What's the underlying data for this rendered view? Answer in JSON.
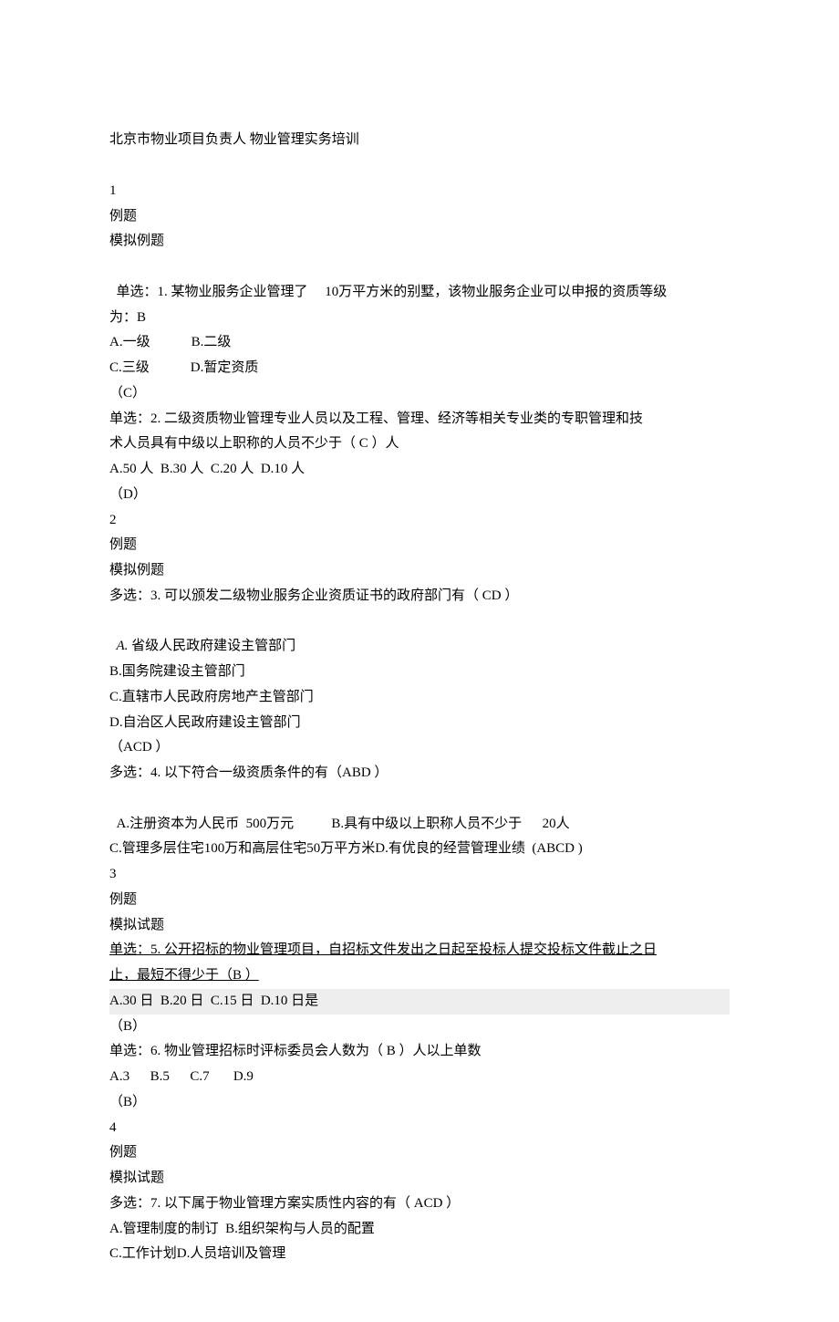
{
  "title": "北京市物业项目负责人 物业管理实务培训",
  "sections": [
    {
      "num": "1",
      "label1": "例题",
      "label2": "模拟例题",
      "q1": {
        "stem_prefix": "单选：1. 某物业服务企业管理了",
        "stem_mid": "10万平方米的别墅，该物业服务企业可以申报的资质等级",
        "stem_suffix": "为：B",
        "opt_line1": "A.一级            B.二级",
        "opt_line2": "C.三级            D.暂定资质",
        "answer": "（C）"
      },
      "q2": {
        "stem_line1": "单选：2. 二级资质物业管理专业人员以及工程、管理、经济等相关专业类的专职管理和技",
        "stem_line2": "术人员具有中级以上职称的人员不少于（ C ）人",
        "opt_line": "A.50 人  B.30 人  C.20 人  D.10 人",
        "answer": "（D）"
      }
    },
    {
      "num": "2",
      "label1": "例题",
      "label2": "模拟例题",
      "q1": {
        "stem": "多选：3. 可以颁发二级物业服务企业资质证书的政府部门有（ CD ）",
        "optA_prefix": "A.",
        "optA": " 省级人民政府建设主管部门",
        "optB": "B.国务院建设主管部门",
        "optC": "C.直辖市人民政府房地产主管部门",
        "optD": "D.自治区人民政府建设主管部门",
        "answer": "（ACD ）"
      },
      "q2": {
        "stem": "多选：4. 以下符合一级资质条件的有（ABD ）",
        "opt_line1_a": "A.注册资本为人民币  500万元",
        "opt_line1_b": "B.具有中级以上职称人员不少于",
        "opt_line1_c": "20人",
        "opt_line2": "C.管理多层住宅100万和高层住宅50万平方米D.有优良的经营管理业绩  (ABCD )"
      }
    },
    {
      "num": "3",
      "label1": "例题",
      "label2": "模拟试题",
      "q1": {
        "stem_line1": "单选：5. 公开招标的物业管理项目，自招标文件发出之日起至投标人提交投标文件截止之日",
        "stem_line2": "止，最短不得少于（B ）",
        "opt_line": "A.30 日  B.20 日  C.15 日  D.10 日是",
        "answer": "（B）"
      },
      "q2": {
        "stem": "单选：6. 物业管理招标时评标委员会人数为（ B ）人以上单数",
        "opt_line": "A.3      B.5      C.7       D.9",
        "answer": "（B）"
      }
    },
    {
      "num": "4",
      "label1": "例题",
      "label2": "模拟试题",
      "q1": {
        "stem": "多选：7. 以下属于物业管理方案实质性内容的有（ ACD ）",
        "opt_line1": "A.管理制度的制订  B.组织架构与人员的配置",
        "opt_line2": "C.工作计划D.人员培训及管理"
      }
    }
  ]
}
